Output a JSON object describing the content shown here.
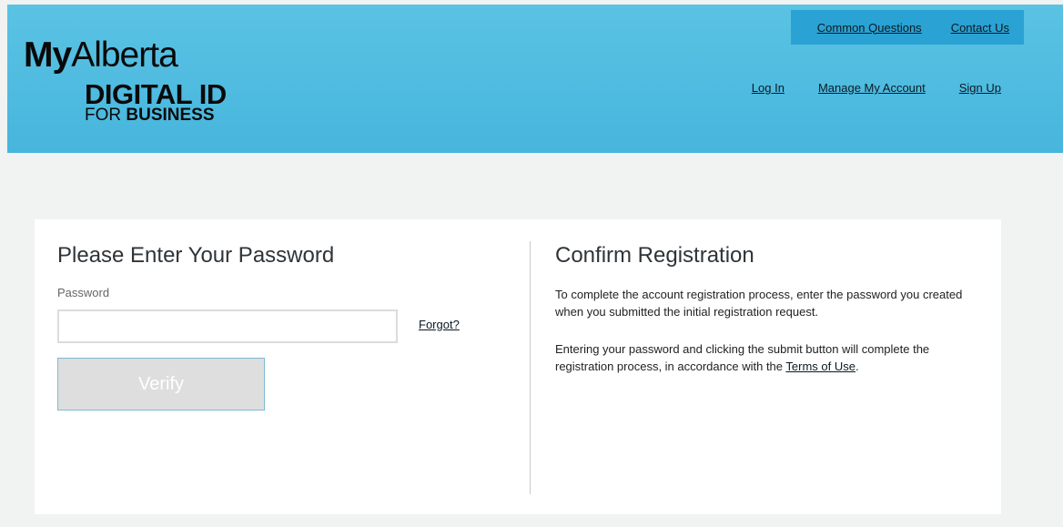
{
  "header": {
    "logo": {
      "my": "My",
      "alberta": "Alberta",
      "digital_id": "DIGITAL ID",
      "for": "FOR",
      "business": "BUSINESS"
    },
    "top_links": {
      "common_questions": "Common Questions",
      "contact_us": "Contact Us"
    },
    "nav": {
      "log_in": "Log In",
      "manage_account": "Manage My Account",
      "sign_up": "Sign Up"
    }
  },
  "password_panel": {
    "title": "Please Enter Your Password",
    "password_label": "Password",
    "password_value": "",
    "forgot_link": "Forgot?",
    "verify_button": "Verify"
  },
  "confirm_panel": {
    "title": "Confirm Registration",
    "paragraph1": "To complete the account registration process, enter the password you created when you submitted the initial registration request.",
    "paragraph2_text": "Entering your password and clicking the submit button will complete the registration process, in accordance with the ",
    "terms_link": "Terms of Use",
    "paragraph2_end": "."
  },
  "colors": {
    "header_bg": "#4dbadf",
    "top_links_bg": "#2aa2d3",
    "page_bg": "#f1f2f2",
    "card_bg": "#ffffff",
    "button_bg": "#dedede"
  }
}
